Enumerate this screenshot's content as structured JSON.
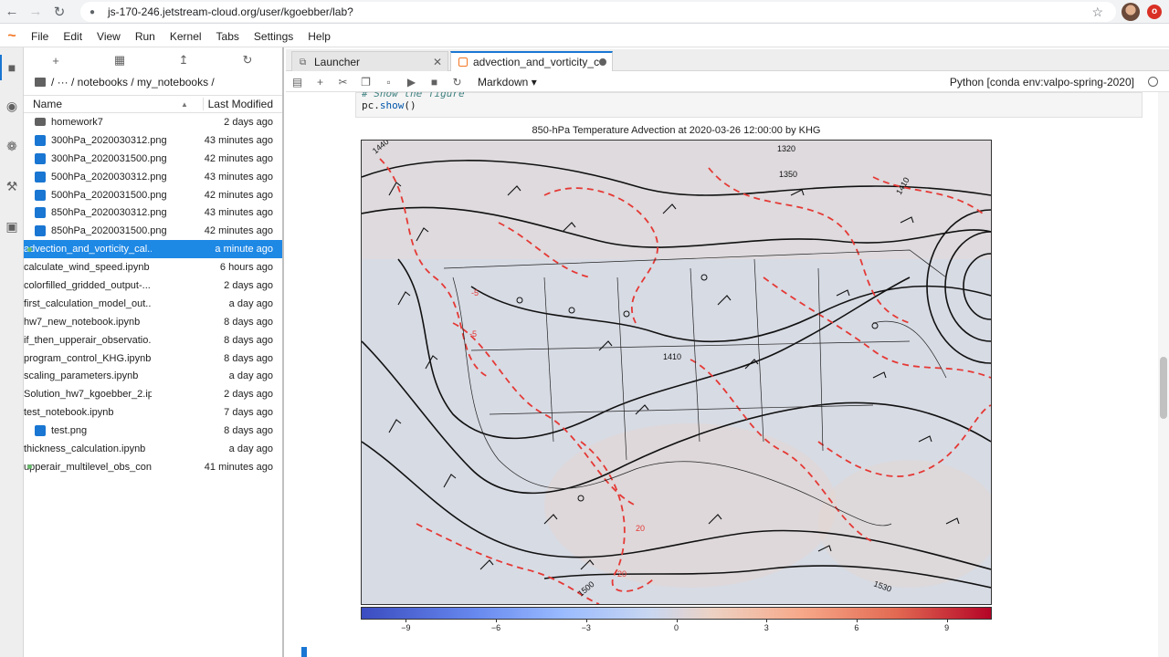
{
  "browser": {
    "url": "js-170-246.jetstream-cloud.org/user/kgoebber/lab?"
  },
  "menu": [
    "File",
    "Edit",
    "View",
    "Run",
    "Kernel",
    "Tabs",
    "Settings",
    "Help"
  ],
  "filebrowser": {
    "breadcrumb": "/ ··· / notebooks / my_notebooks /",
    "col_name": "Name",
    "col_modified": "Last Modified",
    "files": [
      {
        "name": "homework7",
        "modified": "2 days ago",
        "type": "folder"
      },
      {
        "name": "300hPa_2020030312.png",
        "modified": "43 minutes ago",
        "type": "image"
      },
      {
        "name": "300hPa_2020031500.png",
        "modified": "42 minutes ago",
        "type": "image"
      },
      {
        "name": "500hPa_2020030312.png",
        "modified": "43 minutes ago",
        "type": "image"
      },
      {
        "name": "500hPa_2020031500.png",
        "modified": "42 minutes ago",
        "type": "image"
      },
      {
        "name": "850hPa_2020030312.png",
        "modified": "43 minutes ago",
        "type": "image"
      },
      {
        "name": "850hPa_2020031500.png",
        "modified": "42 minutes ago",
        "type": "image"
      },
      {
        "name": "advection_and_vorticity_cal...",
        "modified": "a minute ago",
        "type": "notebook",
        "selected": true,
        "running": true
      },
      {
        "name": "calculate_wind_speed.ipynb",
        "modified": "6 hours ago",
        "type": "notebook"
      },
      {
        "name": "colorfilled_gridded_output-...",
        "modified": "2 days ago",
        "type": "notebook"
      },
      {
        "name": "first_calculation_model_out...",
        "modified": "a day ago",
        "type": "notebook"
      },
      {
        "name": "hw7_new_notebook.ipynb",
        "modified": "8 days ago",
        "type": "notebook"
      },
      {
        "name": "if_then_upperair_observatio...",
        "modified": "8 days ago",
        "type": "notebook"
      },
      {
        "name": "program_control_KHG.ipynb",
        "modified": "8 days ago",
        "type": "notebook"
      },
      {
        "name": "scaling_parameters.ipynb",
        "modified": "a day ago",
        "type": "notebook"
      },
      {
        "name": "Solution_hw7_kgoebber_2.ip...",
        "modified": "2 days ago",
        "type": "notebook"
      },
      {
        "name": "test_notebook.ipynb",
        "modified": "7 days ago",
        "type": "notebook"
      },
      {
        "name": "test.png",
        "modified": "8 days ago",
        "type": "image"
      },
      {
        "name": "thickness_calculation.ipynb",
        "modified": "a day ago",
        "type": "notebook"
      },
      {
        "name": "upperair_multilevel_obs_con...",
        "modified": "41 minutes ago",
        "type": "notebook",
        "running": true
      }
    ]
  },
  "tabs": [
    {
      "label": "Launcher"
    },
    {
      "label": "advection_and_vorticity_calc"
    }
  ],
  "toolbar": {
    "cell_type": "Markdown",
    "kernel": "Python [conda env:valpo-spring-2020]"
  },
  "cell": {
    "comment": "# Show the figure",
    "code_obj": "pc.",
    "code_fn": "show",
    "code_end": "()"
  },
  "figure": {
    "title": "850-hPa Temperature Advection at 2020-03-26 12:00:00 by KHG",
    "contour_labels": [
      "1320",
      "1350",
      "1410",
      "1440",
      "1410",
      "1500",
      "1530",
      "-5",
      "-5",
      "20",
      "20"
    ],
    "colorbar_ticks": [
      "−9",
      "−6",
      "−3",
      "0",
      "3",
      "6",
      "9"
    ]
  }
}
